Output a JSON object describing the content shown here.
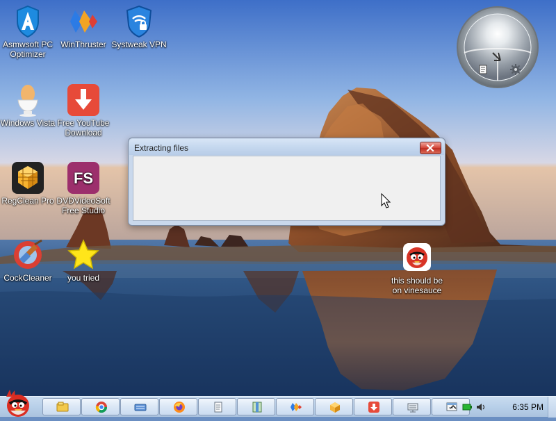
{
  "desktop": {
    "icons": [
      {
        "label": "Asmwsoft PC Optimizer",
        "icon": "asmwsoft-icon"
      },
      {
        "label": "WinThruster",
        "icon": "winthruster-icon"
      },
      {
        "label": "Systweak VPN",
        "icon": "vpn-shield-icon"
      },
      {
        "label": "Windows Vista",
        "icon": "egg-cup-icon"
      },
      {
        "label": "Free YouTube Download",
        "icon": "download-arrow-icon"
      },
      {
        "label": "RegClean Pro",
        "icon": "cube-icon"
      },
      {
        "label": "DVDVideoSoft Free Studio",
        "icon": "fs-logo-icon",
        "badge": "FS"
      },
      {
        "label": "CockCleaner",
        "icon": "broom-icon"
      },
      {
        "label": "you tried",
        "icon": "star-icon"
      },
      {
        "label": "this should be on vinesauce",
        "icon": "angry-bird-icon"
      }
    ]
  },
  "gadget": {
    "name": "desktop-gadget"
  },
  "dialog": {
    "title": "Extracting files"
  },
  "taskbar": {
    "pinned": [
      "explorer-icon",
      "chrome-icon",
      "keyboard-icon",
      "firefox-icon",
      "notepad-icon",
      "archive-icon",
      "winthruster-icon",
      "package-icon",
      "download-icon",
      "network-icon",
      "window-icon"
    ],
    "tray": {
      "time": "6:35 PM"
    }
  },
  "colors": {
    "dialog_close": "#cc3b2f",
    "taskbar": "#bfd3ea"
  }
}
